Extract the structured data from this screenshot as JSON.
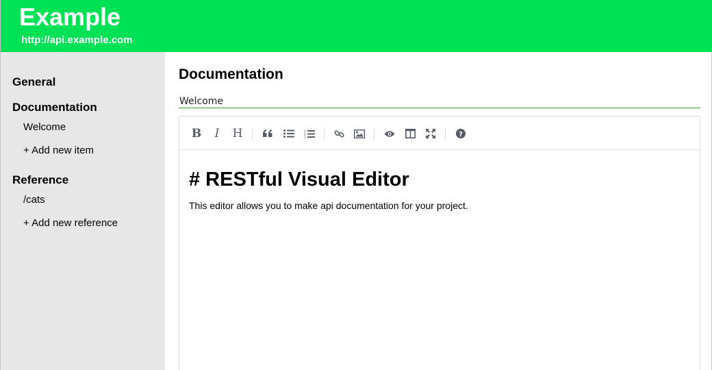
{
  "header": {
    "title": "Example",
    "url": "http://api.example.com"
  },
  "sidebar": {
    "general_label": "General",
    "documentation": {
      "label": "Documentation",
      "items": [
        "Welcome"
      ],
      "add_label": "+ Add new item"
    },
    "reference": {
      "label": "Reference",
      "items": [
        "/cats"
      ],
      "add_label": "+ Add new reference"
    }
  },
  "main": {
    "heading": "Documentation",
    "page_title_value": "Welcome",
    "toolbar": {
      "icons": [
        "bold-icon",
        "italic-icon",
        "heading-icon",
        "quote-icon",
        "unordered-list-icon",
        "ordered-list-icon",
        "link-icon",
        "image-icon",
        "preview-icon",
        "side-by-side-icon",
        "fullscreen-icon",
        "help-icon"
      ],
      "bold_glyph": "B",
      "italic_glyph": "I",
      "heading_glyph": "H"
    },
    "editor": {
      "heading_line": "# RESTful Visual Editor",
      "body_line": "This editor allows you to make api documentation for your project."
    }
  },
  "colors": {
    "header_bg": "#00e255",
    "sidebar_bg": "#e7e7e7",
    "input_underline": "#2aa329",
    "toolbar_icon": "#555c66"
  }
}
